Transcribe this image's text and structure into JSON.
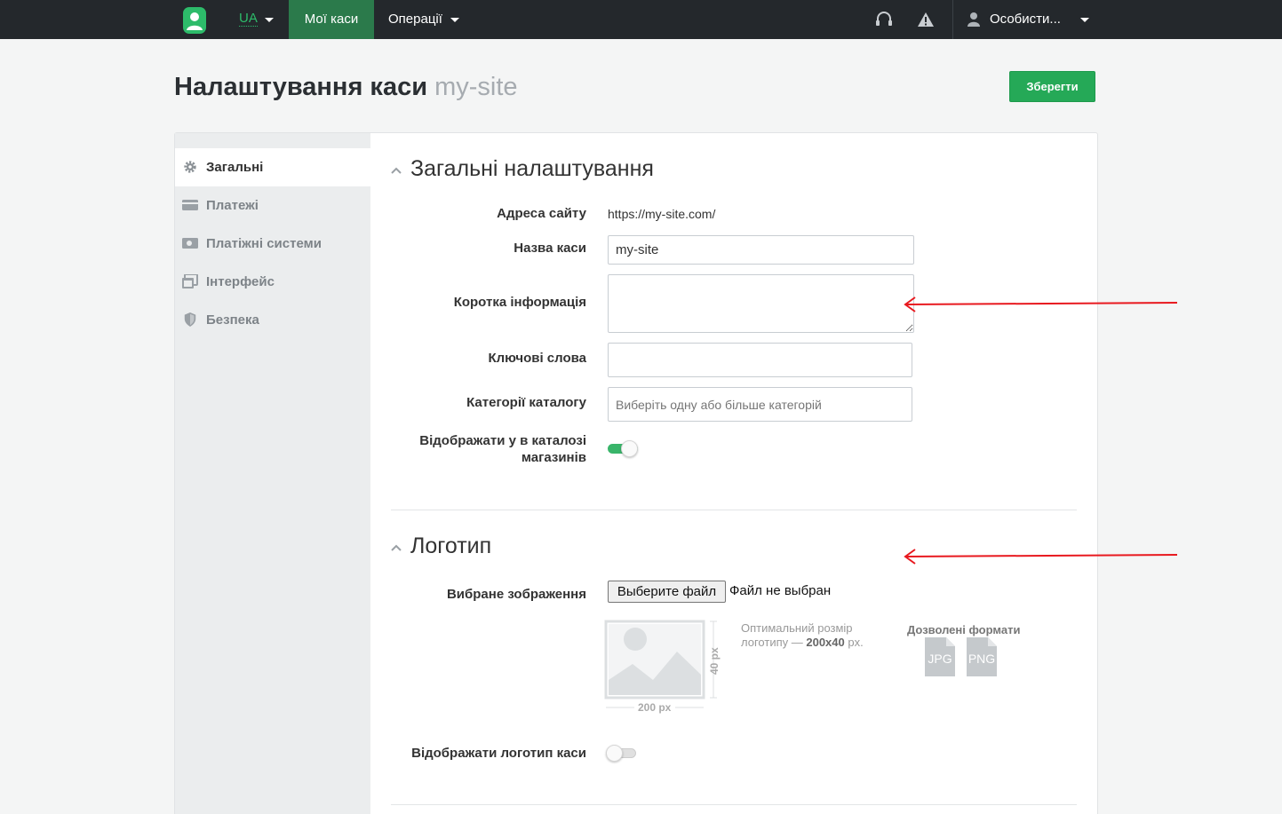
{
  "topbar": {
    "language": "UA",
    "nav_active": "Мої каси",
    "nav_operations": "Операції",
    "profile": "Особисти..."
  },
  "header": {
    "title": "Налаштування каси",
    "subtitle": "my-site",
    "save_label": "Зберегти"
  },
  "sidebar": {
    "items": [
      {
        "label": "Загальні",
        "icon": "gear-icon"
      },
      {
        "label": "Платежі",
        "icon": "card-icon"
      },
      {
        "label": "Платіжні системи",
        "icon": "money-icon"
      },
      {
        "label": "Інтерфейс",
        "icon": "window-icon"
      },
      {
        "label": "Безпека",
        "icon": "shield-icon"
      }
    ]
  },
  "general": {
    "title": "Загальні налаштування",
    "site_url_label": "Адреса сайту",
    "site_url_value": "https://my-site.com/",
    "name_label": "Назва каси",
    "name_value": "my-site",
    "short_info_label": "Коротка інформація",
    "short_info_value": "",
    "keywords_label": "Ключові слова",
    "keywords_value": "",
    "categories_label": "Категорії каталогу",
    "categories_placeholder": "Виберіть одну або більше категорій",
    "catalog_label_1": "Відображати у в каталозі",
    "catalog_label_2": "магазинів",
    "catalog_toggle_on": true
  },
  "logo": {
    "title": "Логотип",
    "image_label": "Вибране зображення",
    "choose_file": "Выберите файл",
    "no_file": "Файл не выбран",
    "hint_1": "Оптимальний розмір",
    "hint_2": "логотипу —",
    "hint_size": "200x40",
    "hint_unit": "px.",
    "width_label": "200 px",
    "height_label": "40 px",
    "formats_title": "Дозволені формати",
    "formats": [
      "JPG",
      "PNG"
    ],
    "show_logo_label": "Відображати логотип каси",
    "show_logo_toggle_on": false
  },
  "colors": {
    "topbar": "#24282c",
    "accent": "#25a957",
    "arrow": "#e8191f"
  }
}
